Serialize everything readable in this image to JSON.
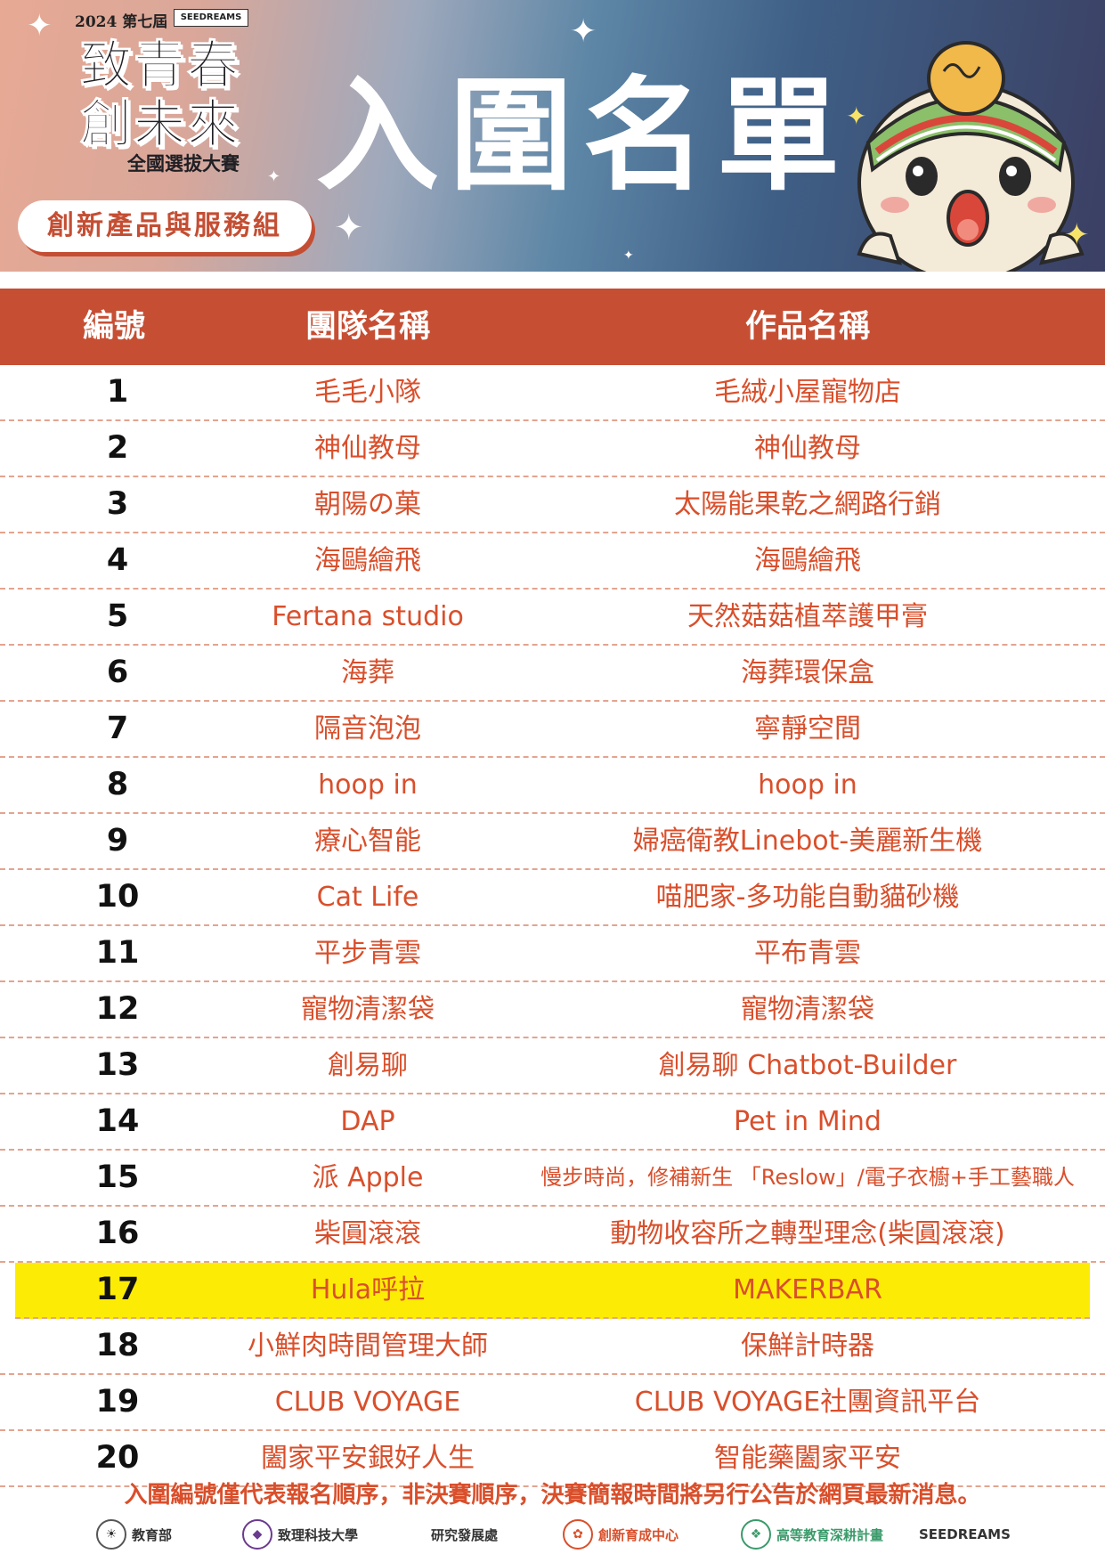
{
  "header": {
    "edition": "2024 第七屆",
    "org_logo_text": "SEEDREAMS",
    "event_title_line1": "致青春",
    "event_title_line2": "創未來",
    "event_subtitle": "全國選拔大賽",
    "group": "創新產品與服務組",
    "title": "入圍名單"
  },
  "table": {
    "headers": {
      "number": "編號",
      "team": "團隊名稱",
      "work": "作品名稱"
    },
    "rows": [
      {
        "number": "1",
        "team": "毛毛小隊",
        "work": "毛絨小屋寵物店"
      },
      {
        "number": "2",
        "team": "神仙教母",
        "work": "神仙教母"
      },
      {
        "number": "3",
        "team": "朝陽の菓",
        "work": "太陽能果乾之網路行銷"
      },
      {
        "number": "4",
        "team": "海鷗繪飛",
        "work": "海鷗繪飛"
      },
      {
        "number": "5",
        "team": "Fertana studio",
        "work": "天然菇菇植萃護甲膏"
      },
      {
        "number": "6",
        "team": "海葬",
        "work": "海葬環保盒"
      },
      {
        "number": "7",
        "team": "隔音泡泡",
        "work": "寧靜空間"
      },
      {
        "number": "8",
        "team": "hoop in",
        "work": "hoop in"
      },
      {
        "number": "9",
        "team": "療心智能",
        "work": "婦癌衛教Linebot-美麗新生機"
      },
      {
        "number": "10",
        "team": "Cat Life",
        "work": "喵肥家-多功能自動貓砂機"
      },
      {
        "number": "11",
        "team": "平步青雲",
        "work": "平布青雲"
      },
      {
        "number": "12",
        "team": "寵物清潔袋",
        "work": "寵物清潔袋"
      },
      {
        "number": "13",
        "team": "創易聊",
        "work": "創易聊 Chatbot-Builder"
      },
      {
        "number": "14",
        "team": "DAP",
        "work": "Pet in Mind"
      },
      {
        "number": "15",
        "team": "派 Apple",
        "work": "慢步時尚，修補新生 「Reslow」/電子衣櫥+手工藝職人"
      },
      {
        "number": "16",
        "team": "柴圓滾滾",
        "work": "動物收容所之轉型理念(柴圓滾滾)"
      },
      {
        "number": "17",
        "team": "Hula呼拉",
        "work": "MAKERBAR"
      },
      {
        "number": "18",
        "team": "小鮮肉時間管理大師",
        "work": "保鮮計時器"
      },
      {
        "number": "19",
        "team": "CLUB VOYAGE",
        "work": "CLUB VOYAGE社團資訊平台"
      },
      {
        "number": "20",
        "team": "闔家平安銀好人生",
        "work": "智能藥闔家平安"
      }
    ]
  },
  "footer": {
    "notice": "入圍編號僅代表報名順序，非決賽順序，決賽簡報時間將另行公告於網頁最新消息。",
    "sponsors": [
      "教育部",
      "致理科技大學",
      "研究發展處",
      "創新育成中心",
      "高等教育深耕計畫",
      "SEEDREAMS"
    ]
  },
  "colors": {
    "accent": "#c64e33",
    "text_red": "#d94f2b",
    "highlight": "#fcec05"
  }
}
